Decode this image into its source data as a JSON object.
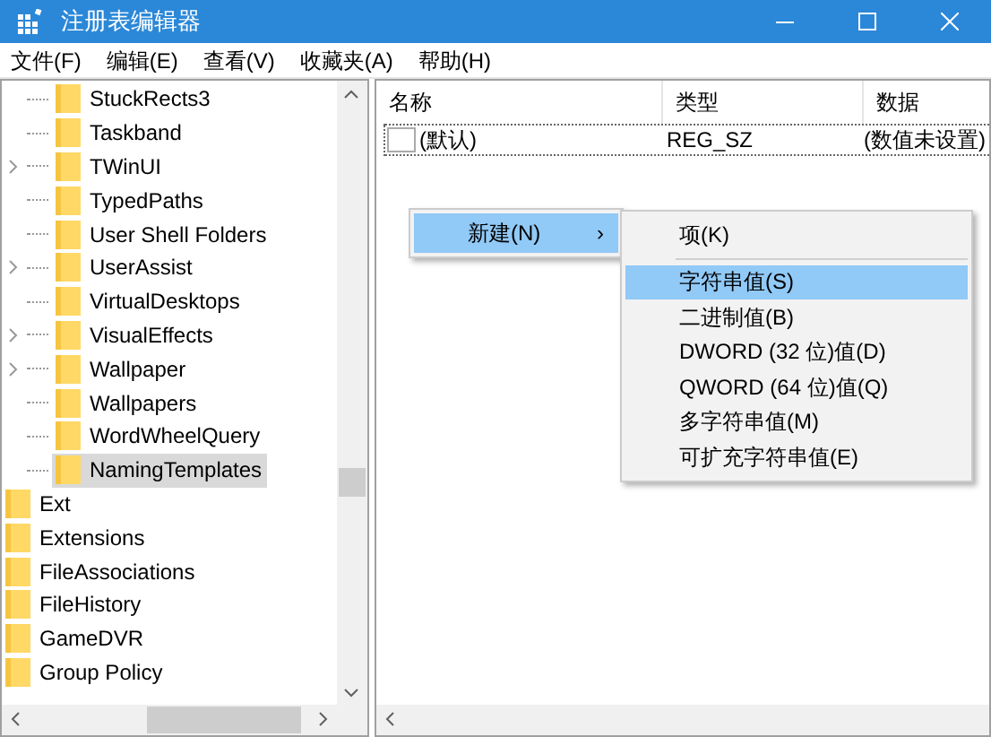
{
  "window": {
    "title": "注册表编辑器"
  },
  "menu_bar": [
    "文件(F)",
    "编辑(E)",
    "查看(V)",
    "收藏夹(A)",
    "帮助(H)"
  ],
  "tree": {
    "items": [
      {
        "children": [
          {
            "label": "StuckRects3",
            "expandable": false,
            "selected": false
          },
          {
            "label": "Taskband",
            "expandable": false,
            "selected": false
          },
          {
            "label": "TWinUI",
            "expandable": true,
            "selected": false
          },
          {
            "label": "TypedPaths",
            "expandable": false,
            "selected": false
          },
          {
            "label": "User Shell Folders",
            "expandable": false,
            "selected": false
          },
          {
            "label": "UserAssist",
            "expandable": true,
            "selected": false
          },
          {
            "label": "VirtualDesktops",
            "expandable": false,
            "selected": false
          },
          {
            "label": "VisualEffects",
            "expandable": true,
            "selected": false
          },
          {
            "label": "Wallpaper",
            "expandable": true,
            "selected": false
          },
          {
            "label": "Wallpapers",
            "expandable": false,
            "selected": false
          },
          {
            "label": "WordWheelQuery",
            "expandable": false,
            "selected": false
          },
          {
            "label": "NamingTemplates",
            "expandable": false,
            "selected": true
          }
        ]
      },
      {
        "label": "Ext",
        "selected": false
      },
      {
        "label": "Extensions",
        "selected": false
      },
      {
        "label": "FileAssociations",
        "selected": false
      },
      {
        "label": "FileHistory",
        "selected": false
      },
      {
        "label": "GameDVR",
        "selected": false
      },
      {
        "label": "Group Policy",
        "selected": false
      }
    ]
  },
  "values_table": {
    "columns": [
      "名称",
      "类型",
      "数据"
    ],
    "rows": [
      {
        "name": "(默认)",
        "type": "REG_SZ",
        "data": "(数值未设置)"
      }
    ]
  },
  "context_menu": {
    "items": [
      {
        "label": "新建(N)",
        "arrow": "›",
        "selected": true
      }
    ]
  },
  "submenu": {
    "items": [
      {
        "label": "项(K)",
        "selected": false
      },
      {
        "label": "字符串值(S)",
        "selected": true
      },
      {
        "label": "二进制值(B)",
        "selected": false
      },
      {
        "label": "DWORD (32 位)值(D)",
        "selected": false
      },
      {
        "label": "QWORD (64 位)值(Q)",
        "selected": false
      },
      {
        "label": "多字符串值(M)",
        "selected": false
      },
      {
        "label": "可扩充字符串值(E)",
        "selected": false
      }
    ]
  }
}
